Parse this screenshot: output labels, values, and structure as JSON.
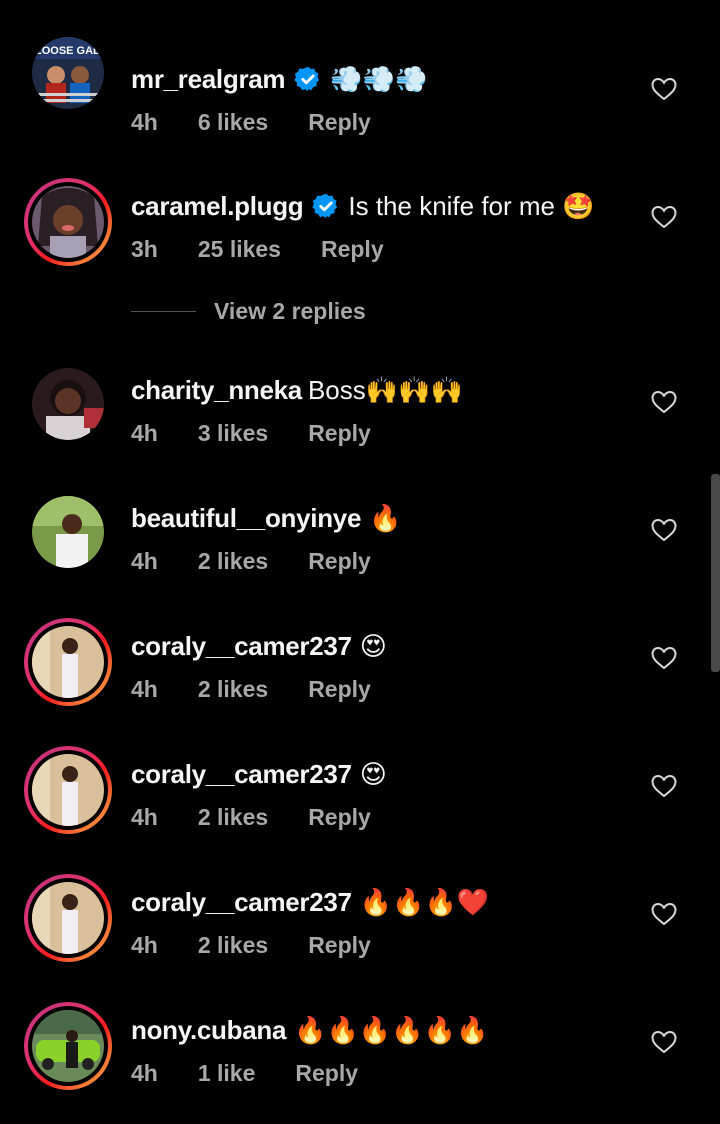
{
  "comments": [
    {
      "username": "mr_realgram",
      "verified": true,
      "text": "💨💨💨",
      "time": "4h",
      "likes": "6 likes",
      "reply": "Reply",
      "avatar_ring": false,
      "avatar_caption": "LOOSE GAD"
    },
    {
      "username": "caramel.plugg",
      "verified": true,
      "text": "Is the knife for me 🤩",
      "time": "3h",
      "likes": "25 likes",
      "reply": "Reply",
      "avatar_ring": true
    },
    {
      "username": "charity_nneka",
      "verified": false,
      "text": "Boss🙌🙌🙌",
      "time": "4h",
      "likes": "3 likes",
      "reply": "Reply",
      "avatar_ring": false
    },
    {
      "username": "beautiful__onyinye",
      "verified": false,
      "text": "🔥",
      "time": "4h",
      "likes": "2 likes",
      "reply": "Reply",
      "avatar_ring": false
    },
    {
      "username": "coraly__camer237",
      "verified": false,
      "text": "😍",
      "time": "4h",
      "likes": "2 likes",
      "reply": "Reply",
      "avatar_ring": true
    },
    {
      "username": "coraly__camer237",
      "verified": false,
      "text": "😍",
      "time": "4h",
      "likes": "2 likes",
      "reply": "Reply",
      "avatar_ring": true
    },
    {
      "username": "coraly__camer237",
      "verified": false,
      "text": "🔥🔥🔥❤️",
      "time": "4h",
      "likes": "2 likes",
      "reply": "Reply",
      "avatar_ring": true
    },
    {
      "username": "nony.cubana",
      "verified": false,
      "text": "🔥🔥🔥🔥🔥🔥",
      "time": "4h",
      "likes": "1 like",
      "reply": "Reply",
      "avatar_ring": true
    }
  ],
  "view_replies": "View 2 replies",
  "icons": {
    "verified": "verified-badge-icon",
    "like": "heart-outline-icon"
  },
  "colors": {
    "background": "#000000",
    "text_primary": "#f5f5f5",
    "text_secondary": "#a8a8a8",
    "verified_blue": "#0095f6",
    "story_ring_start": "#c13584",
    "story_ring_end": "#fcaf45"
  }
}
